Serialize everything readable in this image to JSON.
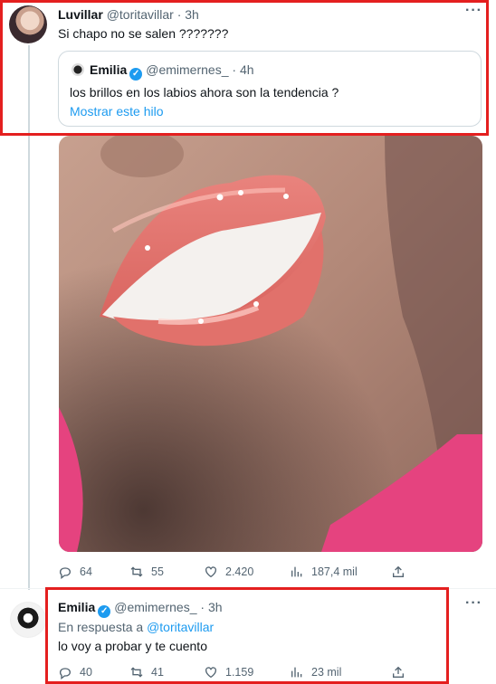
{
  "tweet": {
    "author_name": "Luvillar",
    "author_handle": "@toritavillar",
    "dot": "·",
    "time": "3h",
    "text": "Si chapo no se salen ???????",
    "quoted": {
      "author_name": "Emilia",
      "author_handle": "@emimernes_",
      "dot": "·",
      "time": "4h",
      "text": "los brillos en los labios ahora son la tendencia ?",
      "show_thread": "Mostrar este hilo"
    },
    "stats": {
      "replies": "64",
      "retweets": "55",
      "likes": "2.420",
      "views": "187,4 mil"
    }
  },
  "reply": {
    "author_name": "Emilia",
    "author_handle": "@emimernes_",
    "dot": "·",
    "time": "3h",
    "replying_prefix": "En respuesta a",
    "replying_to": "@toritavillar",
    "text": "lo voy a probar y te cuento",
    "stats": {
      "replies": "40",
      "retweets": "41",
      "likes": "1.159",
      "views": "23 mil"
    }
  },
  "icons": {
    "more": "more-icon",
    "reply": "reply-icon",
    "retweet": "retweet-icon",
    "like": "like-icon",
    "views": "views-icon",
    "share": "share-icon",
    "verified": "verified-icon"
  },
  "colors": {
    "highlight_box": "#e41f1f",
    "link": "#1d9bf0",
    "verified": "#1d9bf0",
    "secondary_text": "#536471"
  }
}
